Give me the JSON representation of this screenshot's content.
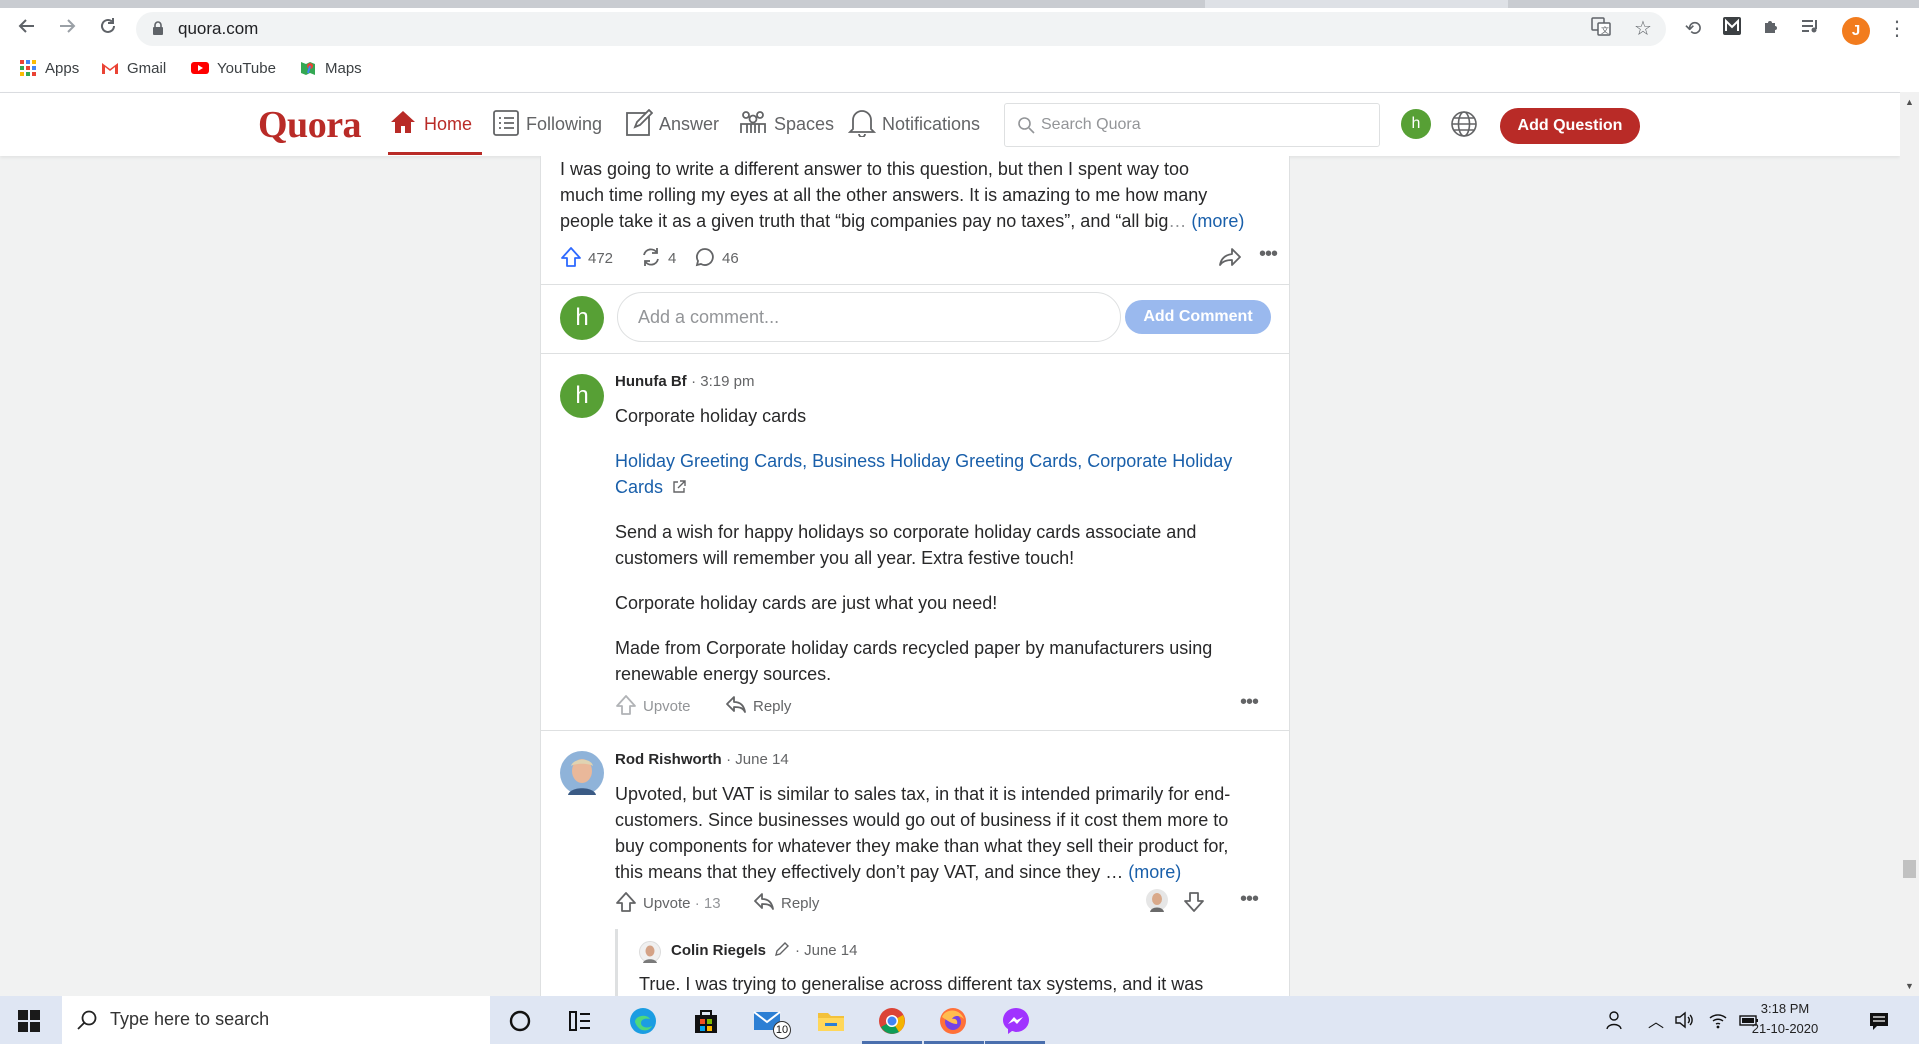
{
  "browser": {
    "url": "quora.com",
    "bookmarks": [
      {
        "label": "Apps"
      },
      {
        "label": "Gmail"
      },
      {
        "label": "YouTube"
      },
      {
        "label": "Maps"
      }
    ],
    "profile_initial": "J"
  },
  "quora": {
    "logo": "Quora",
    "nav": {
      "home": "Home",
      "following": "Following",
      "answer": "Answer",
      "spaces": "Spaces",
      "notifications": "Notifications"
    },
    "search_placeholder": "Search Quora",
    "user_initial": "h",
    "add_question": "Add Question"
  },
  "answer": {
    "text_line1": "I was going to write a different answer to this question, but then I spent way too",
    "text_line2": "much time rolling my eyes at all the other answers. It is amazing to me how many",
    "text_line3": "people take it as a given truth that “big companies pay no taxes”, and “all big",
    "more": "(more)",
    "upvotes": "472",
    "shares": "4",
    "comments": "46"
  },
  "comment_box": {
    "avatar_initial": "h",
    "placeholder": "Add a comment...",
    "button": "Add Comment"
  },
  "comments": [
    {
      "author": "Hunufa Bf",
      "time": "3:19 pm",
      "avatar_initial": "h",
      "title": "Corporate holiday cards",
      "link_line1": "Holiday Greeting Cards, Business Holiday Greeting Cards, Corporate Holiday",
      "link_line2": "Cards",
      "para1_line1": "Send a wish for happy holidays so corporate holiday cards associate and",
      "para1_line2": "customers will remember you all year. Extra festive touch!",
      "para2": "Corporate holiday cards are just what you need!",
      "para3_line1": "Made from Corporate holiday cards recycled paper by manufacturers using",
      "para3_line2": "renewable energy sources.",
      "upvote": "Upvote",
      "reply": "Reply"
    },
    {
      "author": "Rod Rishworth",
      "time": "June 14",
      "line1": "Upvoted, but VAT is similar to sales tax, in that it is intended primarily for end-",
      "line2": "customers. Since businesses would go out of business if it cost them more to",
      "line3": "buy components for whatever they make than what they sell their product for,",
      "line4": "this means that they effectively don’t pay VAT, and since they …",
      "more": "(more)",
      "upvote": "Upvote",
      "upvote_count": "13",
      "reply": "Reply"
    },
    {
      "author": "Colin Riegels",
      "time": "June 14",
      "line1": "True. I was trying to generalise across different tax systems, and it was"
    }
  ],
  "taskbar": {
    "search_placeholder": "Type here to search",
    "mail_badge": "10",
    "time": "3:18 PM",
    "date": "21-10-2020"
  }
}
